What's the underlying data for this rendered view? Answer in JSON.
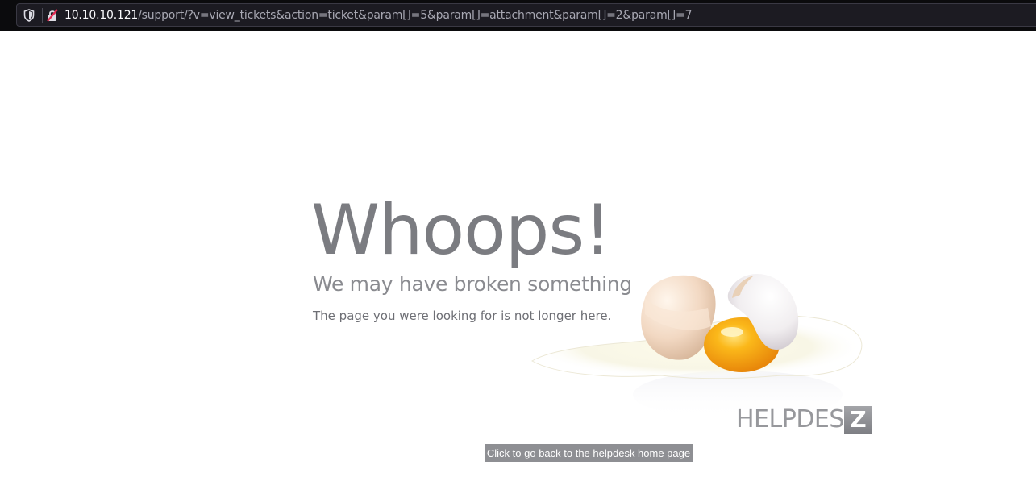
{
  "browser": {
    "url_host": "10.10.10.121",
    "url_path": "/support/?v=view_tickets&action=ticket&param[]=5&param[]=attachment&param[]=2&param[]=7",
    "icons": [
      "shield-icon",
      "insecure-lock-icon"
    ]
  },
  "error": {
    "headline": "Whoops!",
    "subheadline": "We may have broken something",
    "message": "The page you were looking for is not longer here.",
    "home_link_label": "Click to go back to the helpdesk home page"
  },
  "logo": {
    "name": "HELPDESK",
    "badge": "Z"
  },
  "colors": {
    "text_gray": "#7b7c81",
    "button_bg": "#8e8f93",
    "yolk": "#f3a20e"
  }
}
